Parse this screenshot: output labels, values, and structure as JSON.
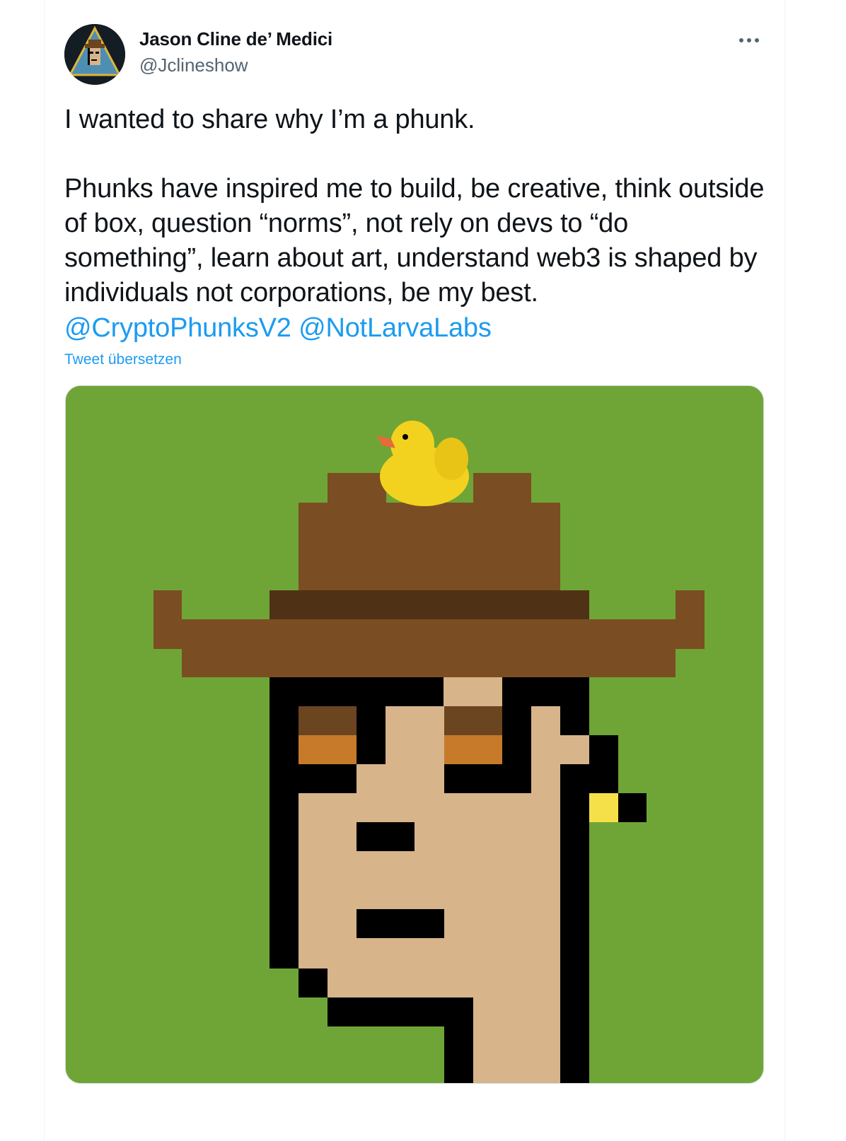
{
  "tweet": {
    "author": {
      "display_name": "Jason Cline de’ Medici",
      "handle": "@Jclineshow",
      "avatar_icon": "triangle-punk-avatar"
    },
    "more_icon": "more-horizontal-icon",
    "text": "I wanted to share why I’m a phunk.\n\nPhunks have inspired me to build, be creative, think outside of box, question “norms”, not rely on devs to “do something”, learn about art, understand web3 is shaped by individuals not corporations, be my best.",
    "mentions": [
      "@CryptoPhunksV2",
      "@NotLarvaLabs"
    ],
    "translate_label": "Tweet übersetzen",
    "media": {
      "description_icon": "pixel-phunk-with-cowboy-hat-and-rubber-duck",
      "colors": {
        "background": "#6fa536",
        "hat": "#7a4e22",
        "hat_band": "#4f3216",
        "skin": "#d8b48a",
        "outline": "#000000",
        "eye_shadow": "#a5692a",
        "earring": "#f5e04a"
      }
    }
  },
  "colors": {
    "accent": "#1d9bf0",
    "text_primary": "#0f1419",
    "text_secondary": "#536471"
  }
}
